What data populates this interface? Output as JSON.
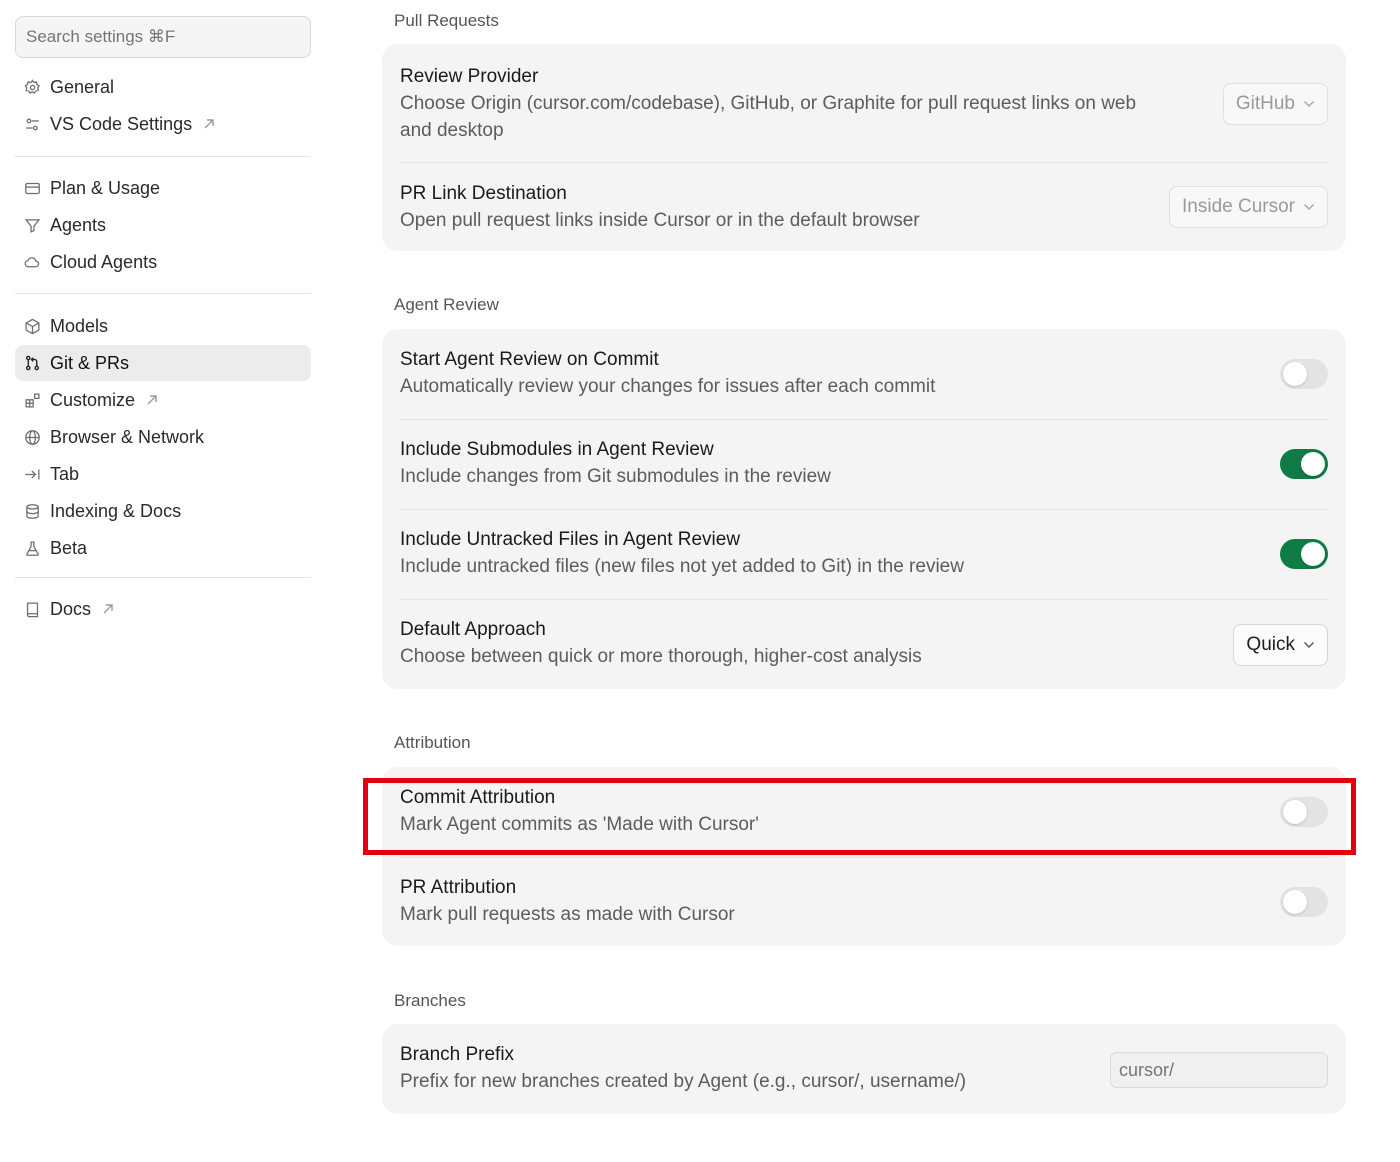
{
  "sidebar": {
    "search_placeholder": "Search settings ⌘F",
    "groups": [
      [
        {
          "label": "General",
          "icon": "gear-icon"
        },
        {
          "label": "VS Code Settings",
          "icon": "sliders-icon",
          "external": true
        }
      ],
      [
        {
          "label": "Plan & Usage",
          "icon": "credit-card-icon"
        },
        {
          "label": "Agents",
          "icon": "funnel-icon"
        },
        {
          "label": "Cloud Agents",
          "icon": "cloud-icon"
        }
      ],
      [
        {
          "label": "Models",
          "icon": "cube-icon"
        },
        {
          "label": "Git & PRs",
          "icon": "git-pull-request-icon",
          "active": true
        },
        {
          "label": "Customize",
          "icon": "blocks-icon",
          "external": true
        },
        {
          "label": "Browser & Network",
          "icon": "globe-icon"
        },
        {
          "label": "Tab",
          "icon": "tab-arrow-icon"
        },
        {
          "label": "Indexing & Docs",
          "icon": "database-icon"
        },
        {
          "label": "Beta",
          "icon": "flask-icon"
        }
      ],
      [
        {
          "label": "Docs",
          "icon": "book-icon",
          "external": true
        }
      ]
    ]
  },
  "sections": {
    "pull_requests": {
      "title": "Pull Requests",
      "review_provider": {
        "title": "Review Provider",
        "desc_line1": "Choose Origin (cursor.com/codebase), GitHub, or Graphite for pull request links on web",
        "desc_line2": "and desktop",
        "value": "GitHub"
      },
      "pr_link_destination": {
        "title": "PR Link Destination",
        "desc": "Open pull request links inside Cursor or in the default browser",
        "value": "Inside Cursor"
      }
    },
    "agent_review": {
      "title": "Agent Review",
      "start_on_commit": {
        "title": "Start Agent Review on Commit",
        "desc": "Automatically review your changes for issues after each commit",
        "enabled": false
      },
      "include_submodules": {
        "title": "Include Submodules in Agent Review",
        "desc": "Include changes from Git submodules in the review",
        "enabled": true
      },
      "include_untracked": {
        "title": "Include Untracked Files in Agent Review",
        "desc": "Include untracked files (new files not yet added to Git) in the review",
        "enabled": true
      },
      "default_approach": {
        "title": "Default Approach",
        "desc": "Choose between quick or more thorough, higher-cost analysis",
        "value": "Quick"
      }
    },
    "attribution": {
      "title": "Attribution",
      "commit_attribution": {
        "title": "Commit Attribution",
        "desc": "Mark Agent commits as 'Made with Cursor'",
        "enabled": false
      },
      "pr_attribution": {
        "title": "PR Attribution",
        "desc": "Mark pull requests as made with Cursor",
        "enabled": false
      }
    },
    "branches": {
      "title": "Branches",
      "branch_prefix": {
        "title": "Branch Prefix",
        "desc": "Prefix for new branches created by Agent (e.g., cursor/, username/)",
        "placeholder": "cursor/"
      }
    }
  },
  "colors": {
    "toggle_on": "#0f7b45",
    "toggle_off": "#e3e3e3",
    "highlight": "#e3000f"
  }
}
